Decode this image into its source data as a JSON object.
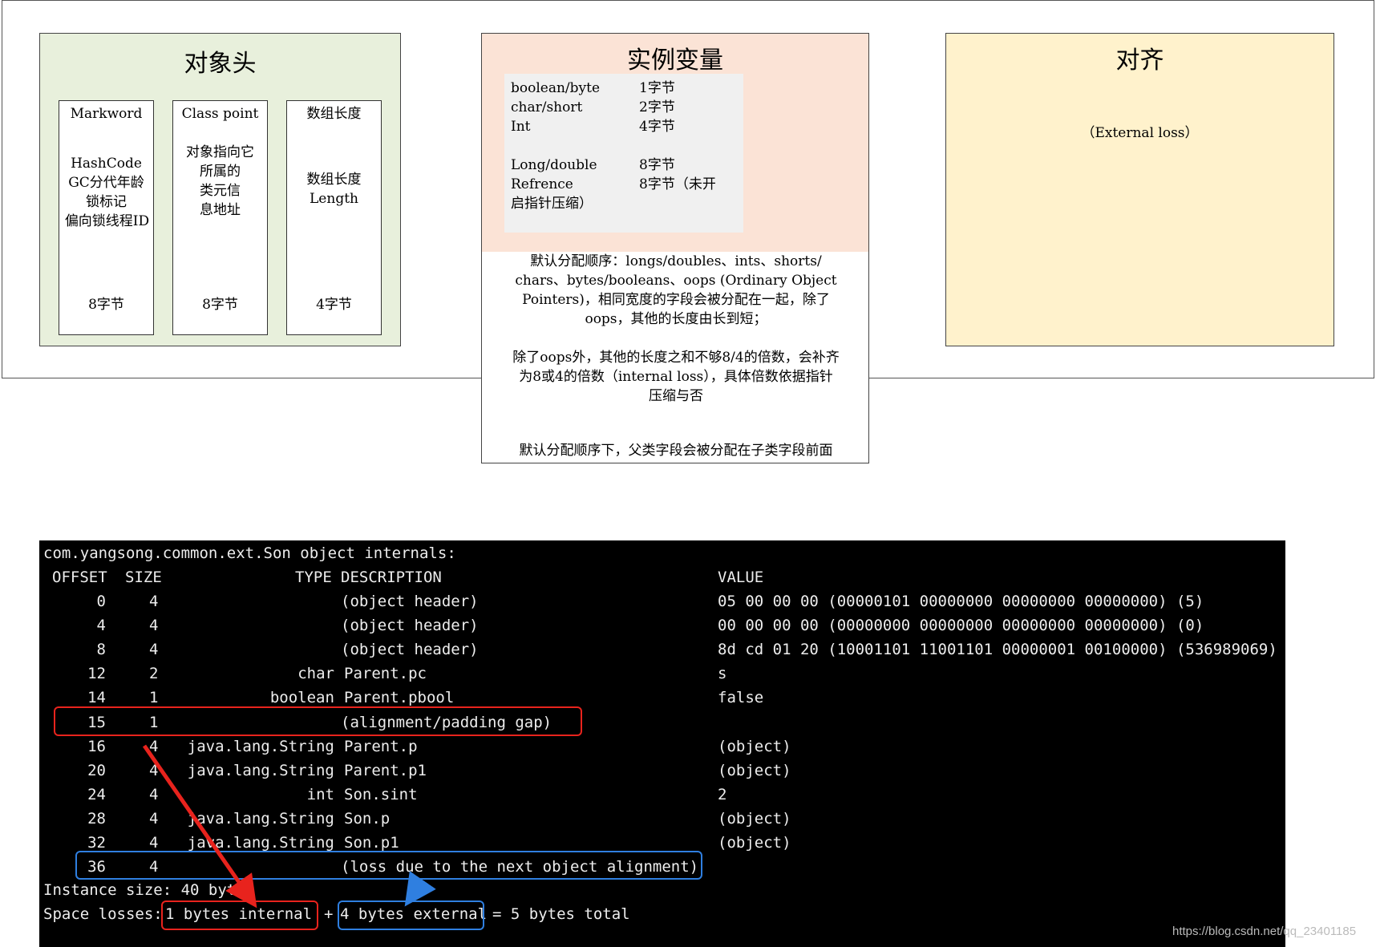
{
  "header": {
    "title": "对象头",
    "markword": {
      "label": "Markword",
      "lines": [
        "HashCode",
        "GC分代年龄",
        "锁标记",
        "偏向锁线程ID"
      ],
      "size": "8字节"
    },
    "class_point": {
      "label": "Class point",
      "lines": [
        "对象指向它",
        "所属的",
        "类元信",
        "息地址"
      ],
      "size": "8字节"
    },
    "array_length": {
      "label": "数组长度",
      "lines": [
        "数组长度",
        "Length"
      ],
      "size": "4字节"
    }
  },
  "instance": {
    "title": "实例变量",
    "types": [
      {
        "type": "boolean/byte",
        "size": "1字节"
      },
      {
        "type": "char/short",
        "size": "2字节"
      },
      {
        "type": "Int",
        "size": "4字节"
      },
      {
        "type": "Long/double",
        "size": "8字节"
      },
      {
        "type": "Refrence",
        "size": "8字节（未开"
      },
      {
        "type": "启指针压缩）",
        "size": ""
      }
    ],
    "notes": [
      [
        "默认分配顺序：longs/doubles、ints、shorts/",
        "chars、bytes/booleans、oops (Ordinary Object",
        "Pointers)，相同宽度的字段会被分配在一起，除了",
        "oops，其他的长度由长到短；"
      ],
      [
        "除了oops外，其他的长度之和不够8/4的倍数，会补齐",
        "为8或4的倍数（internal loss），具体倍数依据指针",
        "压缩与否"
      ],
      [
        "默认分配顺序下，父类字段会被分配在子类字段前面"
      ]
    ]
  },
  "align": {
    "title": "对齐",
    "text": "（External loss）"
  },
  "terminal": {
    "title": "com.yangsong.common.ext.Son object internals:",
    "headers": {
      "offset": "OFFSET",
      "size": "SIZE",
      "type": "TYPE",
      "description": "DESCRIPTION",
      "value": "VALUE"
    },
    "rows": [
      {
        "offset": "0",
        "size": "4",
        "type": "",
        "description": "(object header)",
        "value": "05 00 00 00 (00000101 00000000 00000000 00000000) (5)"
      },
      {
        "offset": "4",
        "size": "4",
        "type": "",
        "description": "(object header)",
        "value": "00 00 00 00 (00000000 00000000 00000000 00000000) (0)"
      },
      {
        "offset": "8",
        "size": "4",
        "type": "",
        "description": "(object header)",
        "value": "8d cd 01 20 (10001101 11001101 00000001 00100000) (536989069)"
      },
      {
        "offset": "12",
        "size": "2",
        "type": "char",
        "description": "Parent.pc",
        "value": "s"
      },
      {
        "offset": "14",
        "size": "1",
        "type": "boolean",
        "description": "Parent.pbool",
        "value": "false"
      },
      {
        "offset": "15",
        "size": "1",
        "type": "",
        "description": "(alignment/padding gap)",
        "value": ""
      },
      {
        "offset": "16",
        "size": "4",
        "type": "java.lang.String",
        "description": "Parent.p",
        "value": "(object)"
      },
      {
        "offset": "20",
        "size": "4",
        "type": "java.lang.String",
        "description": "Parent.p1",
        "value": "(object)"
      },
      {
        "offset": "24",
        "size": "4",
        "type": "int",
        "description": "Son.sint",
        "value": "2"
      },
      {
        "offset": "28",
        "size": "4",
        "type": "java.lang.String",
        "description": "Son.p",
        "value": "(object)"
      },
      {
        "offset": "32",
        "size": "4",
        "type": "java.lang.String",
        "description": "Son.p1",
        "value": "(object)"
      },
      {
        "offset": "36",
        "size": "4",
        "type": "",
        "description": "(loss due to the next object alignment)",
        "value": ""
      }
    ],
    "instance_size": "Instance size: 40 bytes",
    "space_losses": {
      "label": "Space losses:",
      "internal": "1 bytes internal",
      "plus": "+",
      "external": "4 bytes external",
      "total": "= 5 bytes total"
    }
  },
  "colors": {
    "internal_highlight": "#e8231d",
    "external_highlight": "#2f7fe0"
  },
  "watermark": "https://blog.csdn.net/qq_23401185"
}
